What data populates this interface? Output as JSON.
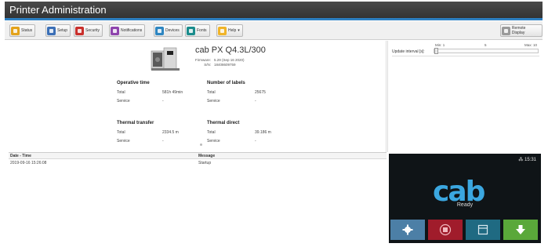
{
  "window": {
    "title": "Printer Administration"
  },
  "toolbar": {
    "items": [
      {
        "label": "Status",
        "icon": "status-icon",
        "color": "#e3a21a"
      },
      {
        "label": "Setup",
        "icon": "setup-icon",
        "color": "#3b6fb6"
      },
      {
        "label": "Security",
        "icon": "security-icon",
        "color": "#c9302c"
      },
      {
        "label": "Notifications",
        "icon": "notifications-icon",
        "color": "#8e44ad"
      },
      {
        "label": "Devices",
        "icon": "devices-icon",
        "color": "#2e86c1"
      },
      {
        "label": "Fonts",
        "icon": "fonts-icon",
        "color": "#1a8c8c"
      },
      {
        "label": "Help",
        "icon": "help-icon",
        "color": "#f0b428"
      }
    ],
    "remote_display": "Remote Display"
  },
  "printer": {
    "model": "cab PX Q4.3L/300",
    "firmware_label": "Firmware:",
    "firmware_value": "5.29 (Sep 16 2020)",
    "sn_label": "S/N:",
    "sn_value": "18408609759"
  },
  "stats": {
    "operative_time": {
      "title": "Operative time",
      "total_label": "Total",
      "total_value": "581h 49min",
      "service_label": "Service",
      "service_value": "-"
    },
    "number_of_labels": {
      "title": "Number of labels",
      "total_label": "Total",
      "total_value": "25675",
      "service_label": "Service",
      "service_value": "-"
    },
    "thermal_transfer": {
      "title": "Thermal transfer",
      "total_label": "Total",
      "total_value": "2334.5 m",
      "service_label": "Service",
      "service_value": "-"
    },
    "thermal_direct": {
      "title": "Thermal direct",
      "total_label": "Total",
      "total_value": "39.186 m",
      "service_label": "Service",
      "service_value": "-"
    }
  },
  "update_interval": {
    "label": "Update interval [s]:",
    "min": "Min: 1",
    "mid": "5",
    "max": "Max: 10",
    "value": 1
  },
  "log": {
    "col_date": "Date - Time",
    "col_message": "Message",
    "rows": [
      {
        "date": "2019-09-16 15:26:08",
        "message": "Startup"
      }
    ]
  },
  "display": {
    "status": "15:31",
    "logo_text": "cab",
    "ready_text": "Ready",
    "buttons": [
      {
        "icon": "gear-icon",
        "color": "#4c7fa6"
      },
      {
        "icon": "stop-icon",
        "color": "#a01c2b"
      },
      {
        "icon": "menu-icon",
        "color": "#1f6a82"
      },
      {
        "icon": "arrow-down-icon",
        "color": "#5aa83a"
      }
    ]
  }
}
